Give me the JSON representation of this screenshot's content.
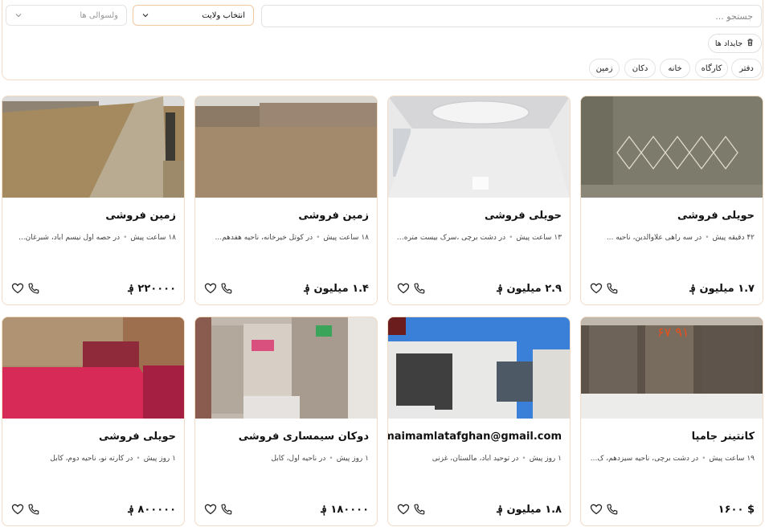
{
  "filters": {
    "search_placeholder": "جستجو ...",
    "province_label": "انتخاب ولایت",
    "district_placeholder": "ولسوالی ها",
    "saved_label": "جایداد ها",
    "categories": [
      "دفتر",
      "کارگاه",
      "خانه",
      "دکان",
      "زمین"
    ]
  },
  "listings": [
    {
      "title": "حویلی فروشی",
      "time": "۴۲ دقیقه پیش",
      "location": "در سه راهی علاوالدین، ناحیه ...",
      "price": "۱.۷ میلیون ؋"
    },
    {
      "title": "حویلی فروشی",
      "time": "۱۳ ساعت پیش",
      "location": "در دشت برچی ،سرک بیست متره ...",
      "price": "۲.۹ میلیون ؋"
    },
    {
      "title": "زمین فروشی",
      "time": "۱۸ ساعت پیش",
      "location": "در کوتل خیرخانه، ناحیه هفدهم...",
      "price": "۱.۴ میلیون ؋"
    },
    {
      "title": "زمین فروشی",
      "time": "۱۸ ساعت پیش",
      "location": "در حصه اول نیسم آباد، شبرغان...",
      "price": "۲۲۰۰۰۰ ؋"
    },
    {
      "title": "کانتینر جامپا",
      "time": "۱۹ ساعت پیش",
      "location": "در دشت برچی، ناحیه سیزدهم، ک...",
      "price": "$ ۱۶۰۰"
    },
    {
      "title": "Rahnmaimamlatafghan@gmail.com",
      "time": "۱ روز پیش",
      "location": "در توحید آباد، مالستان، غزنی",
      "price": "۱.۸ میلیون ؋"
    },
    {
      "title": "دوکان سیمساری فروشی",
      "time": "۱ روز پیش",
      "location": "در ناحیه اول، کابل",
      "price": "۱۸۰۰۰۰ ؋"
    },
    {
      "title": "حویلی فروشی",
      "time": "۱ روز پیش",
      "location": "در کارته نو، ناحیه دوم، کابل",
      "price": "۸۰۰۰۰۰ ؋"
    }
  ],
  "colors": {
    "accent_border": "#f3dcc6",
    "province_border": "#f0c9a0"
  }
}
